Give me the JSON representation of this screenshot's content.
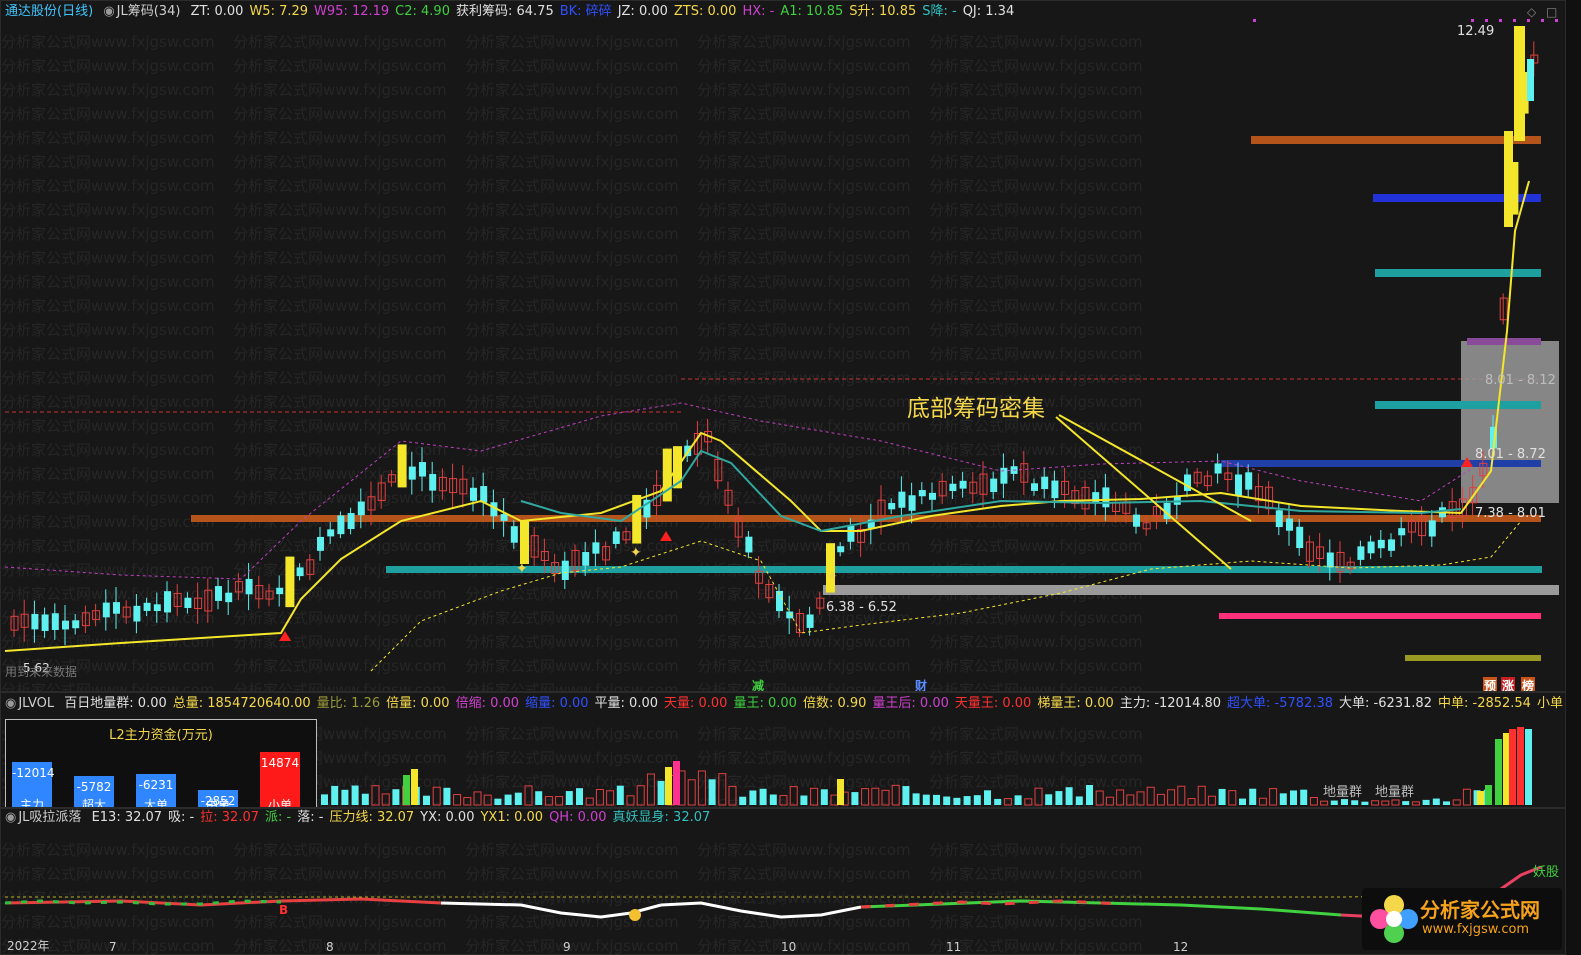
{
  "main": {
    "stock": "通达股份",
    "period": "(日线)",
    "indicator": "JL筹码(34)",
    "header": [
      {
        "t": "ZT: 0.00",
        "c": "#e0e0e0"
      },
      {
        "t": "W5: 7.29",
        "c": "#f4d84a"
      },
      {
        "t": "W95: 12.19",
        "c": "#d040d0"
      },
      {
        "t": "C2: 4.90",
        "c": "#40d040"
      },
      {
        "t": "获利筹码: 64.75",
        "c": "#e0e0e0"
      },
      {
        "t": "BK: 碎碎",
        "c": "#3050ff"
      },
      {
        "t": "JZ: 0.00",
        "c": "#e0e0e0"
      },
      {
        "t": "ZTS: 0.00",
        "c": "#f4d84a"
      },
      {
        "t": "HX: -",
        "c": "#d040d0"
      },
      {
        "t": "A1: 10.85",
        "c": "#40d040"
      },
      {
        "t": "S升: 10.85",
        "c": "#f4d84a"
      },
      {
        "t": "S降: -",
        "c": "#30c0c0"
      },
      {
        "t": "QJ: 1.34",
        "c": "#e0e0e0"
      }
    ],
    "price_high": "12.49",
    "annotation": "底部筹码密集",
    "range_labels": [
      "6.38 - 6.52",
      "8.01 - 8.12",
      "8.01 - 8.72",
      "7.38 - 8.01"
    ],
    "low_label": "5.62",
    "data_note": "用到未来数据",
    "bottom_labels": [
      {
        "t": "减",
        "c": "#40d040"
      },
      {
        "t": "财",
        "c": "#5a8cff"
      },
      {
        "t": "预",
        "c": "#ff8c1a"
      },
      {
        "t": "涨",
        "c": "#ff3030"
      },
      {
        "t": "榜",
        "c": "#ff8c1a"
      }
    ]
  },
  "vol": {
    "title": "JLVOL",
    "fields": [
      {
        "t": "百日地量群: 0.00",
        "c": "#e0e0e0"
      },
      {
        "t": "总量: 1854720640.00",
        "c": "#f4d84a"
      },
      {
        "t": "量比: 1.26",
        "c": "#9a9a3a"
      },
      {
        "t": "倍量: 0.00",
        "c": "#f4d84a"
      },
      {
        "t": "倍缩: 0.00",
        "c": "#d040d0"
      },
      {
        "t": "缩量: 0.00",
        "c": "#3050ff"
      },
      {
        "t": "平量: 0.00",
        "c": "#e0e0e0"
      },
      {
        "t": "天量: 0.00",
        "c": "#ff3030"
      },
      {
        "t": "量王: 0.00",
        "c": "#40d040"
      },
      {
        "t": "倍数: 0.90",
        "c": "#f4d84a"
      },
      {
        "t": "量王后: 0.00",
        "c": "#d040d0"
      },
      {
        "t": "天量王: 0.00",
        "c": "#ff3030"
      },
      {
        "t": "梯量王: 0.00",
        "c": "#f4d84a"
      },
      {
        "t": "主力: -12014.80",
        "c": "#e0e0e0"
      },
      {
        "t": "超大单: -5782.38",
        "c": "#3050ff"
      },
      {
        "t": "大单: -6231.82",
        "c": "#e0e0e0"
      },
      {
        "t": "中单: -2852.54",
        "c": "#f4d84a"
      },
      {
        "t": "小单",
        "c": "#f4d84a"
      }
    ],
    "l2_title": "L2主力资金(万元)",
    "l2": [
      {
        "val": "-12014",
        "cap": "主力",
        "c": "#2f86ff",
        "h": 52
      },
      {
        "val": "-5782",
        "cap": "超大",
        "c": "#2f86ff",
        "h": 38
      },
      {
        "val": "-6231",
        "cap": "大单",
        "c": "#2f86ff",
        "h": 40
      },
      {
        "val": "-2852",
        "cap": "中单",
        "c": "#2f86ff",
        "h": 24
      },
      {
        "val": "14874",
        "cap": "小单",
        "c": "#ff1a1a",
        "h": 62
      }
    ],
    "ground_labels": [
      "地量群",
      "地量群"
    ]
  },
  "ind": {
    "title": "JL吸拉派落",
    "fields": [
      {
        "t": "E13: 32.07",
        "c": "#e0e0e0"
      },
      {
        "t": "吸: -",
        "c": "#e0e0e0"
      },
      {
        "t": "拉: 32.07",
        "c": "#ff3030"
      },
      {
        "t": "派: -",
        "c": "#40d040"
      },
      {
        "t": "落: -",
        "c": "#e0e0e0"
      },
      {
        "t": "压力线: 32.07",
        "c": "#f4d84a"
      },
      {
        "t": "YX: 0.00",
        "c": "#e0e0e0"
      },
      {
        "t": "YX1: 0.00",
        "c": "#f4d84a"
      },
      {
        "t": "QH: 0.00",
        "c": "#d040d0"
      },
      {
        "t": "真妖显身: 32.07",
        "c": "#30c0c0"
      }
    ],
    "yao_label": "妖股",
    "b_label": "B"
  },
  "dates": [
    "2022年",
    "7",
    "8",
    "9",
    "10",
    "11",
    "12"
  ],
  "watermark": "分析家公式网www.fxjgsw.com",
  "logo": {
    "name": "分析家公式网",
    "url": "www.fxjgsw.com"
  }
}
